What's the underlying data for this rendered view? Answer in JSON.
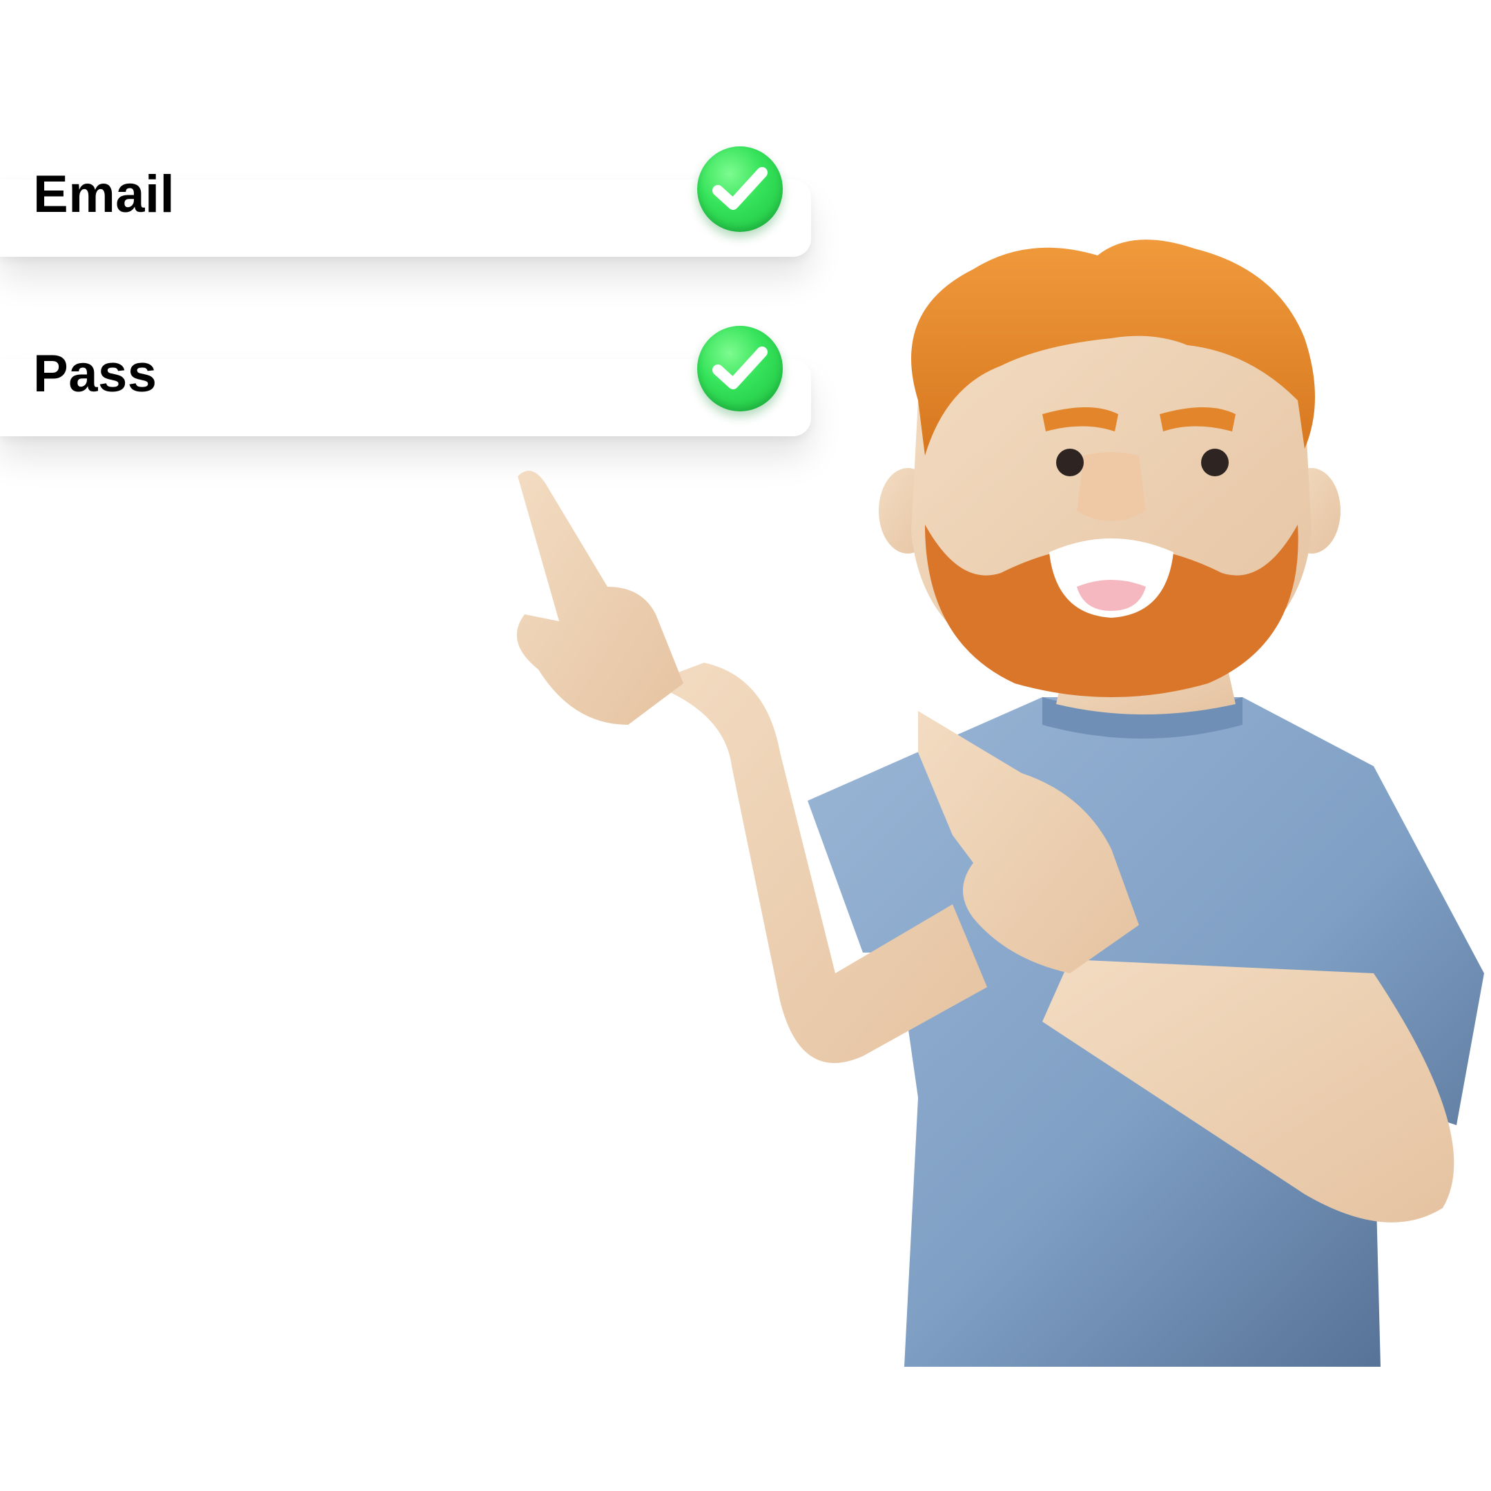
{
  "form_fields": [
    {
      "label": "Email",
      "status_icon": "check-circle-icon",
      "status": "valid",
      "status_color": "#2fdc55"
    },
    {
      "label": "Pass",
      "status_icon": "check-circle-icon",
      "status": "valid",
      "status_color": "#2fdc55"
    }
  ],
  "illustration": {
    "subject": "character-pointing",
    "colors": {
      "hair": "#e2852b",
      "skin": "#efd1b2",
      "shirt": "#7f9fc4"
    }
  }
}
